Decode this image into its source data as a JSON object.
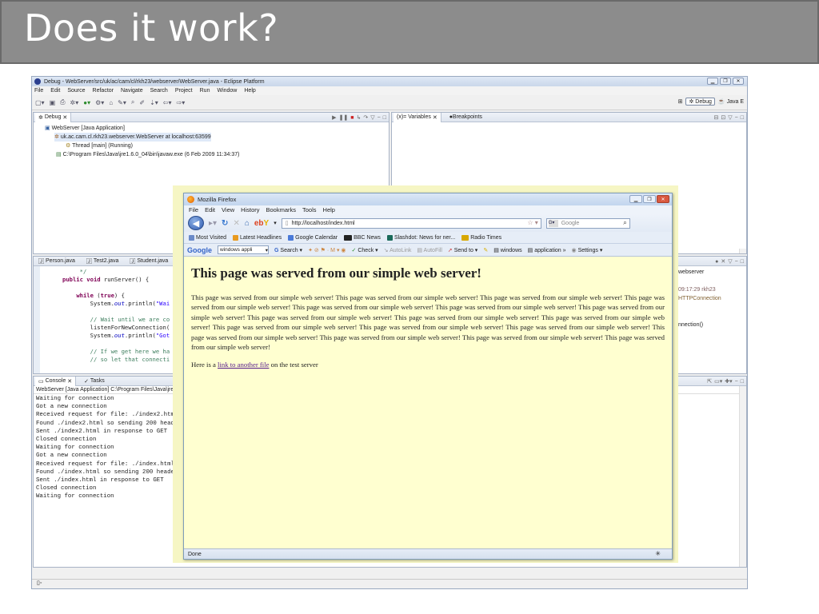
{
  "slide": {
    "title": "Does it work?"
  },
  "eclipse": {
    "window_title": "Debug - WebServer/src/uk/ac/cam/cl/rkh23/webserver/WebServer.java - Eclipse Platform",
    "menu": [
      "File",
      "Edit",
      "Source",
      "Refactor",
      "Navigate",
      "Search",
      "Project",
      "Run",
      "Window",
      "Help"
    ],
    "perspectives": {
      "debug": "Debug",
      "java": "Java E"
    },
    "debug_view": {
      "tab": "Debug",
      "tree": [
        "WebServer [Java Application]",
        "uk.ac.cam.cl.rkh23.webserver.WebServer at localhost:63599",
        "Thread [main] (Running)",
        "C:\\Program Files\\Java\\jre1.6.0_04\\bin\\javaw.exe (6 Feb 2009 11:34:37)"
      ]
    },
    "variables_view": {
      "tab_variables": "Variables",
      "tab_breakpoints": "Breakpoints"
    },
    "editor": {
      "tabs": [
        "Person.java",
        "Test2.java",
        "Student.java"
      ],
      "lines": {
        "l1": "*/",
        "l2_kw": "public void",
        "l2_rest": " runServer() {",
        "l3_kw": "while",
        "l3_rest": " (",
        "l3_true": "true",
        "l3_end": ") {",
        "l4_a": "System.",
        "l4_out": "out",
        "l4_b": ".println(",
        "l4_str": "\"Wai",
        "l5": "// Wait until we are co",
        "l6": "listenForNewConnection(",
        "l7_a": "System.",
        "l7_out": "out",
        "l7_b": ".println(",
        "l7_str": "\"Got",
        "l8": "// If we get here we ha",
        "l9": "// so let that connecti"
      }
    },
    "outline_fragments": [
      "webserver",
      "09:17:29  rkh23",
      "HTTPConnection",
      "nnection()"
    ],
    "console": {
      "tab_console": "Console",
      "tab_tasks": "Tasks",
      "header": "WebServer [Java Application] C:\\Program Files\\Java\\jre1.6.0",
      "lines": [
        "Waiting for connection",
        "Got a new connection",
        "Received request for file: ./index2.htm",
        "Found ./index2.html so sending 200 head",
        "Sent ./index2.html in response to GET",
        "Closed connection",
        "Waiting for connection",
        "Got a new connection",
        "Received request for file: ./index.html",
        "Found ./index.html so sending 200 heade",
        "Sent ./index.html in response to GET",
        "Closed connection",
        "Waiting for connection"
      ]
    }
  },
  "firefox": {
    "window_title": "Mozilla Firefox",
    "menu": [
      "File",
      "Edit",
      "View",
      "History",
      "Bookmarks",
      "Tools",
      "Help"
    ],
    "url": "http://localhost/index.html",
    "search_placeholder": "Google",
    "bookmarks": [
      "Most Visited",
      "Latest Headlines",
      "Google Calendar",
      "BBC News",
      "Slashdot: News for ner...",
      "Radio Times"
    ],
    "google_toolbar": {
      "logo": "Google",
      "input": "windows appli",
      "items": [
        "Search",
        "Check",
        "AutoLink",
        "AutoFill",
        "Send to",
        "windows",
        "application",
        "Settings"
      ]
    },
    "page": {
      "heading": "This page was served from our simple web server!",
      "paragraph": "This page was served from our simple web server! This page was served from our simple web server! This page was served from our simple web server! This page was served from our simple web server! This page was served from our simple web server! This page was served from our simple web server! This page was served from our simple web server! This page was served from our simple web server! This page was served from our simple web server! This page was served from our simple web server! This page was served from our simple web server! This page was served from our simple web server! This page was served from our simple web server! This page was served from our simple web server! This page was served from our simple web server! This page was served from our simple web server! This page was served from our simple web server!",
      "link_prefix": "Here is a ",
      "link_text": "link to another file",
      "link_suffix": " on the test server"
    },
    "status": "Done"
  }
}
